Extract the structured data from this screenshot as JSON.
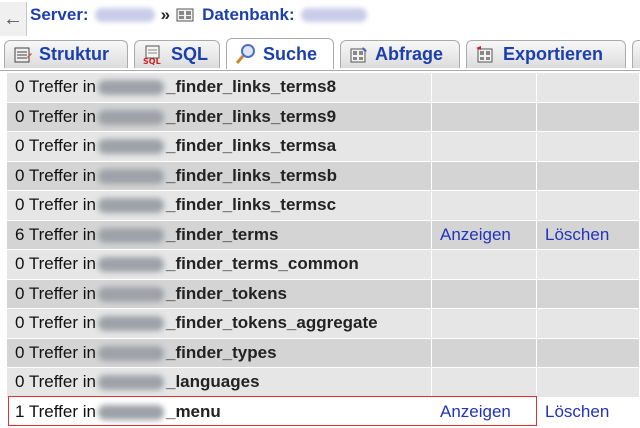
{
  "breadcrumb": {
    "back_glyph": "←",
    "server_label": "Server:",
    "separator": "»",
    "database_label": "Datenbank:"
  },
  "tabs": [
    {
      "label": "Struktur",
      "icon": "structure-icon",
      "active": false
    },
    {
      "label": "SQL",
      "icon": "sql-icon",
      "active": false
    },
    {
      "label": "Suche",
      "icon": "search-icon",
      "active": true
    },
    {
      "label": "Abfrage",
      "icon": "query-icon",
      "active": false
    },
    {
      "label": "Exportieren",
      "icon": "export-icon",
      "active": false
    }
  ],
  "results": {
    "prefix": "Treffer in",
    "rows": [
      {
        "count": "0",
        "table": "_finder_links_terms8",
        "show": "",
        "delete": ""
      },
      {
        "count": "0",
        "table": "_finder_links_terms9",
        "show": "",
        "delete": ""
      },
      {
        "count": "0",
        "table": "_finder_links_termsa",
        "show": "",
        "delete": ""
      },
      {
        "count": "0",
        "table": "_finder_links_termsb",
        "show": "",
        "delete": ""
      },
      {
        "count": "0",
        "table": "_finder_links_termsc",
        "show": "",
        "delete": ""
      },
      {
        "count": "6",
        "table": "_finder_terms",
        "show": "Anzeigen",
        "delete": "Löschen"
      },
      {
        "count": "0",
        "table": "_finder_terms_common",
        "show": "",
        "delete": ""
      },
      {
        "count": "0",
        "table": "_finder_tokens",
        "show": "",
        "delete": ""
      },
      {
        "count": "0",
        "table": "_finder_tokens_aggregate",
        "show": "",
        "delete": ""
      },
      {
        "count": "0",
        "table": "_finder_types",
        "show": "",
        "delete": ""
      },
      {
        "count": "0",
        "table": "_languages",
        "show": "",
        "delete": ""
      },
      {
        "count": "1",
        "table": "_menu",
        "show": "Anzeigen",
        "delete": "Löschen"
      }
    ]
  },
  "colors": {
    "link": "#2233bb",
    "tab_text": "#1c3fae",
    "highlight_border": "#e23030"
  }
}
